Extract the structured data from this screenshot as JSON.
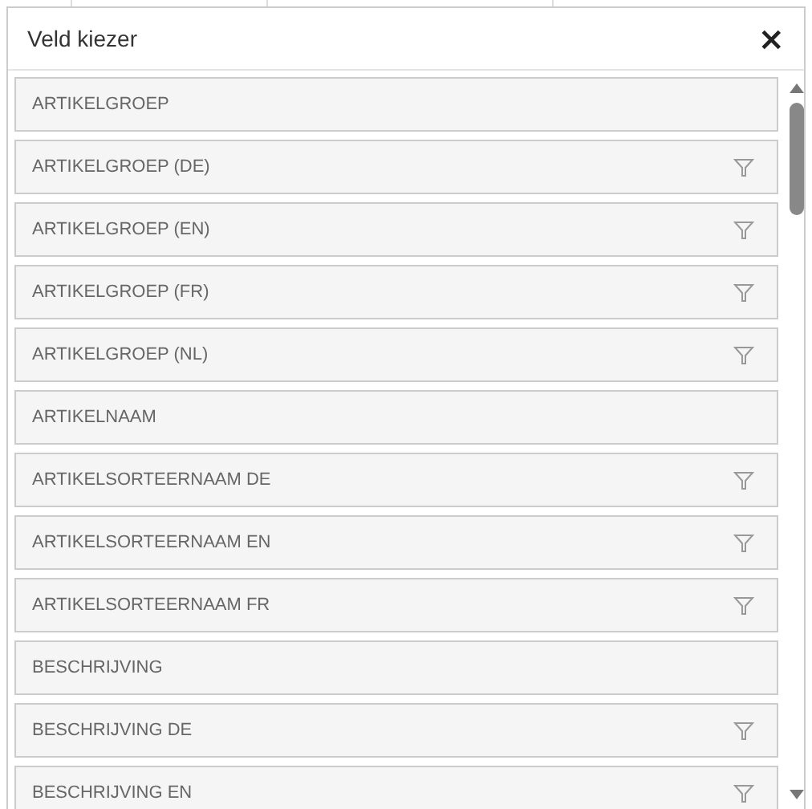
{
  "dialog": {
    "title": "Veld kiezer",
    "close": "×"
  },
  "fields": [
    {
      "label": "ARTIKELGROEP",
      "filter": false
    },
    {
      "label": "ARTIKELGROEP (DE)",
      "filter": true
    },
    {
      "label": "ARTIKELGROEP (EN)",
      "filter": true
    },
    {
      "label": "ARTIKELGROEP (FR)",
      "filter": true
    },
    {
      "label": "ARTIKELGROEP (NL)",
      "filter": true
    },
    {
      "label": "ARTIKELNAAM",
      "filter": false
    },
    {
      "label": "ARTIKELSORTEERNAAM DE",
      "filter": true
    },
    {
      "label": "ARTIKELSORTEERNAAM EN",
      "filter": true
    },
    {
      "label": "ARTIKELSORTEERNAAM FR",
      "filter": true
    },
    {
      "label": "BESCHRIJVING",
      "filter": false
    },
    {
      "label": "BESCHRIJVING DE",
      "filter": true
    },
    {
      "label": "BESCHRIJVING EN",
      "filter": true
    }
  ]
}
